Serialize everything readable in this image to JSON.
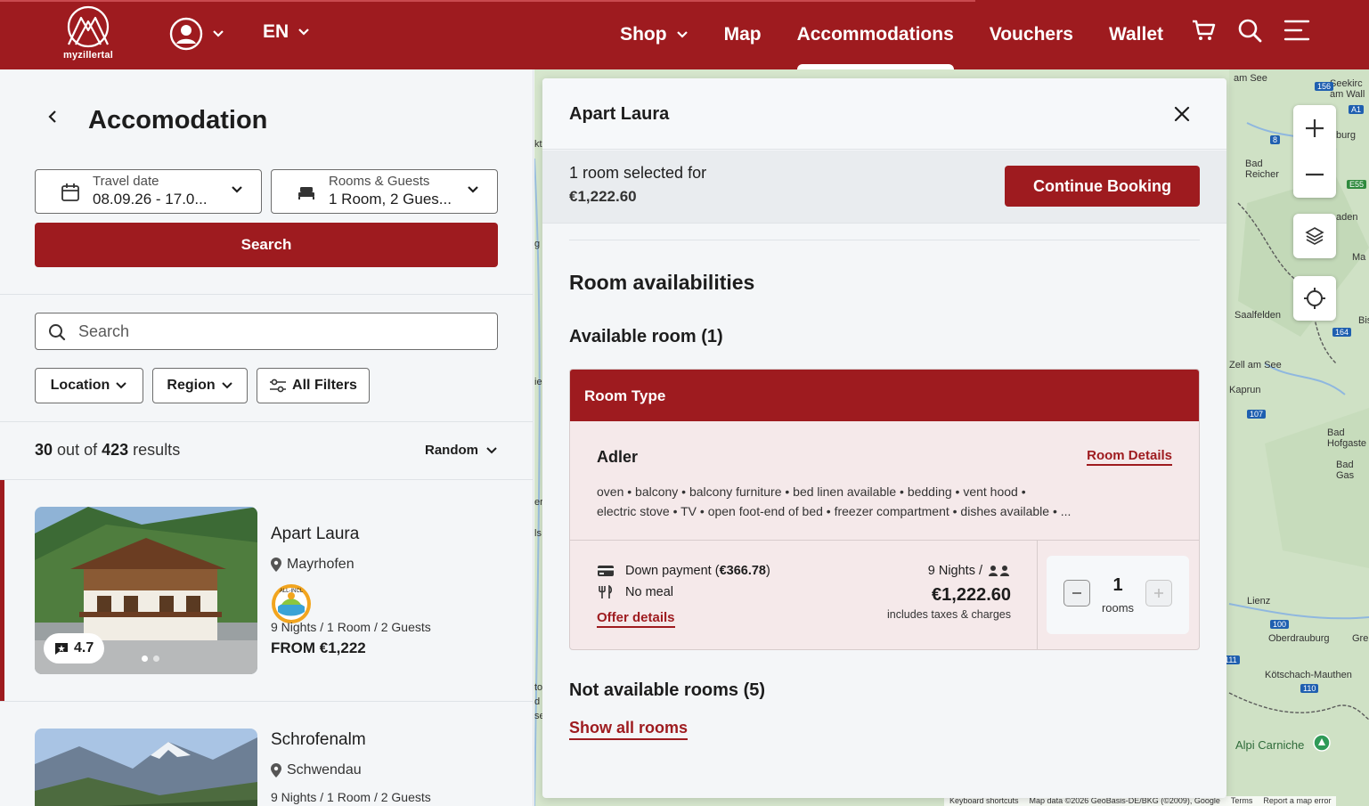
{
  "header": {
    "logo_text": "myzillertal",
    "language": "EN",
    "nav": [
      {
        "label": "Shop"
      },
      {
        "label": "Map"
      },
      {
        "label": "Accommodations"
      },
      {
        "label": "Vouchers"
      },
      {
        "label": "Wallet"
      }
    ],
    "active_nav": "Accommodations",
    "icons": [
      "user-icon",
      "cart-icon",
      "search-icon",
      "menu-icon"
    ]
  },
  "search_panel": {
    "title": "Accomodation",
    "travel_date": {
      "label": "Travel date",
      "value": "08.09.26 - 17.0..."
    },
    "rooms_guests": {
      "label": "Rooms & Guests",
      "value": "1 Room, 2 Gues..."
    },
    "search_button": "Search",
    "search_placeholder": "Search",
    "filters": {
      "location": "Location",
      "region": "Region",
      "all_filters": "All Filters"
    },
    "results": {
      "shown": "30",
      "of_text": "out of",
      "total": "423",
      "suffix": "results"
    },
    "sort": "Random"
  },
  "listings": [
    {
      "name": "Apart Laura",
      "location": "Mayrhofen",
      "badge": "ALL-INCL",
      "rating": "4.7",
      "stay": "9 Nights / 1 Room / 2 Guests",
      "price": "FROM €1,222",
      "selected": true
    },
    {
      "name": "Schrofenalm",
      "location": "Schwendau",
      "stay": "9 Nights / 1 Room / 2 Guests"
    }
  ],
  "detail_panel": {
    "title": "Apart Laura",
    "selection_text": "1 room selected for",
    "selection_price": "€1,222.60",
    "continue_button": "Continue Booking",
    "room_availabilities": "Room availabilities",
    "available_heading": "Available room (1)",
    "room_type_header": "Room Type",
    "room": {
      "name": "Adler",
      "details_link": "Room Details",
      "amenities_line1": "oven • balcony • balcony furniture • bed linen available • bedding • vent hood •",
      "amenities_line2": "electric stove • TV • open foot-end of bed • freezer compartment • dishes available • ..."
    },
    "offer": {
      "down_payment_prefix": "Down payment (",
      "down_payment_amount": "€366.78",
      "down_payment_suffix": ")",
      "meal": "No meal",
      "offer_details": "Offer details",
      "nights": "9 Nights /",
      "price": "€1,222.60",
      "tax_note": "includes taxes & charges",
      "quantity": "1",
      "quantity_unit": "rooms"
    },
    "not_available_heading": "Not available rooms (5)",
    "show_all": "Show all rooms"
  },
  "map": {
    "labels": [
      "am See",
      "Seekirc am Wall",
      "burg",
      "Bad Reicher",
      "aden",
      "Saalfelden",
      "Zell am See",
      "Kaprun",
      "Bad Hofgaste",
      "Bad Gas",
      "Lienz",
      "Oberdrauburg",
      "Gre",
      "Kötschach-Mauthen",
      "Alpi Carniche",
      "Ma",
      "Bis",
      "kt",
      "g",
      "ie",
      "er",
      "ls",
      "to",
      "d",
      "se"
    ],
    "road_numbers": [
      "8",
      "15",
      "156",
      "A1",
      "8",
      "E55",
      "164",
      "107",
      "100",
      "111",
      "110"
    ],
    "footer": [
      "Keyboard shortcuts",
      "Map data ©2026 GeoBasis-DE/BKG (©2009), Google",
      "Terms",
      "Report a map error"
    ]
  },
  "colors": {
    "brand": "#9e1b1f",
    "map_base": "#d8e8cf"
  }
}
